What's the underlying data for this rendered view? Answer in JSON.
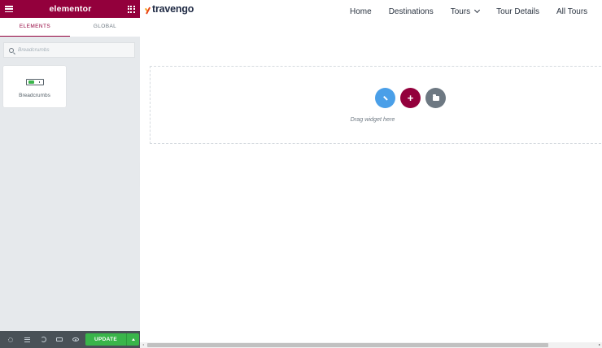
{
  "panel": {
    "brand": "elementor",
    "tabs": [
      {
        "label": "ELEMENTS",
        "active": true
      },
      {
        "label": "GLOBAL",
        "active": false
      }
    ],
    "search": {
      "placeholder": "Breadcrumbs",
      "value": ""
    },
    "widgets": [
      {
        "label": "Breadcrumbs",
        "icon": "breadcrumbs-icon"
      }
    ],
    "footer": {
      "icons": [
        "settings-icon",
        "navigator-icon",
        "history-icon",
        "responsive-mode-icon",
        "preview-icon"
      ],
      "update_label": "UPDATE"
    }
  },
  "site": {
    "logo": "travengo",
    "nav": [
      "Home",
      "Destinations",
      "Tours",
      "Tour Details",
      "All Tours"
    ]
  },
  "drop_zone": {
    "text": "Drag widget here"
  },
  "colors": {
    "brand": "#93003c",
    "update": "#39b54a",
    "panel_bg": "#e6e9ec",
    "footer_bg": "#495157"
  }
}
